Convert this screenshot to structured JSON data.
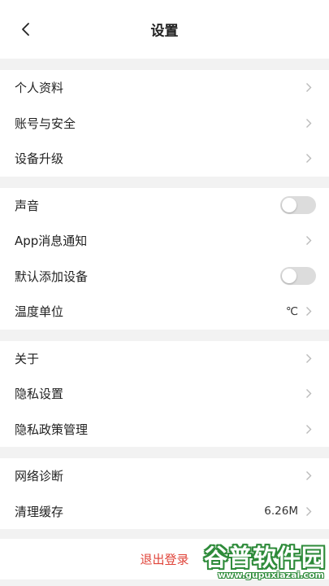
{
  "header": {
    "title": "设置",
    "back_icon": "chevron-left-icon"
  },
  "groups": [
    {
      "items": [
        {
          "label": "个人资料"
        },
        {
          "label": "账号与安全"
        },
        {
          "label": "设备升级"
        }
      ]
    },
    {
      "items": [
        {
          "label": "声音",
          "toggle": false
        },
        {
          "label": "App消息通知"
        },
        {
          "label": "默认添加设备",
          "toggle": false
        },
        {
          "label": "温度单位",
          "value": "℃"
        }
      ]
    },
    {
      "items": [
        {
          "label": "关于"
        },
        {
          "label": "隐私设置"
        },
        {
          "label": "隐私政策管理"
        }
      ]
    },
    {
      "items": [
        {
          "label": "网络诊断"
        },
        {
          "label": "清理缓存",
          "value": "6.26M"
        }
      ]
    }
  ],
  "logout_label": "退出登录",
  "watermark": {
    "brand": "谷普软件园",
    "url": "www.gupuxiazai.com"
  },
  "colors": {
    "accent_logout": "#e0443a",
    "toggle_off": "#dcdcdc",
    "watermark": "#2e8b3a"
  }
}
